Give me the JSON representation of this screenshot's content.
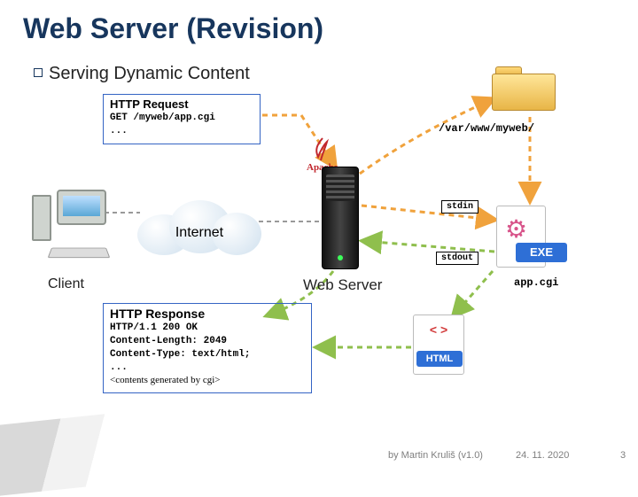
{
  "title": "Web Server (Revision)",
  "subtitle": "Serving Dynamic Content",
  "request": {
    "title": "HTTP Request",
    "line1": "GET /myweb/app.cgi",
    "line2": "..."
  },
  "response": {
    "title": "HTTP Response",
    "line1": "HTTP/1.1 200 OK",
    "line2": "Content-Length: 2049",
    "line3": "Content-Type: text/html;",
    "line4": "...",
    "line5": "<contents generated by cgi>"
  },
  "labels": {
    "client": "Client",
    "webserver": "Web Server",
    "internet": "Internet",
    "path": "/var/www/myweb/",
    "app": "app.cgi",
    "stdin": "stdin",
    "stdout": "stdout",
    "apache": "Apache",
    "exe": "EXE",
    "html": "HTML"
  },
  "footer": {
    "author": "by Martin Kruliš (v1.0)",
    "date": "24. 11. 2020",
    "page": "3"
  },
  "colors": {
    "accent": "#3464c4",
    "titleblue": "#17365d"
  }
}
